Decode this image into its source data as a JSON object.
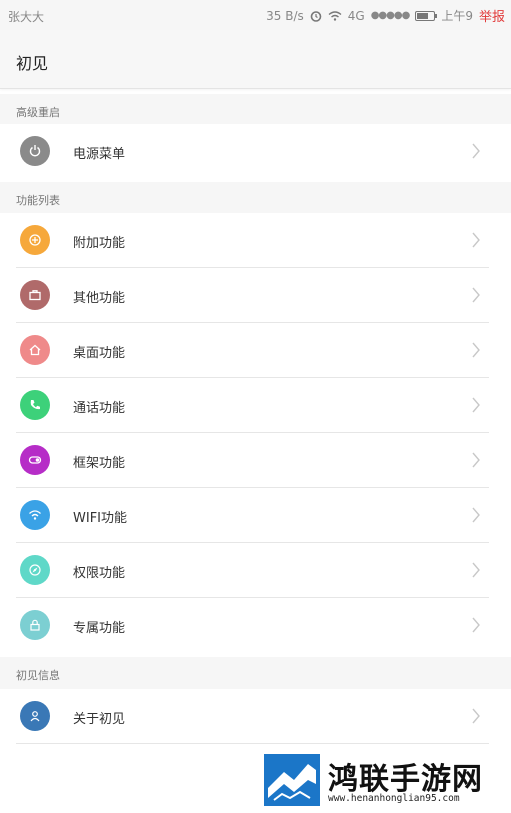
{
  "status_bar": {
    "carrier": "张大大",
    "speed": "35 B/s",
    "network": "4G",
    "signal": "●●●●●",
    "time": "上午9",
    "report": "举报"
  },
  "header": {
    "title": "初见"
  },
  "sections": [
    {
      "title": "高级重启"
    },
    {
      "title": "功能列表"
    },
    {
      "title": "初见信息"
    }
  ],
  "items": [
    {
      "label": "电源菜单",
      "icon": "power-icon",
      "color": "#8a8a8a"
    },
    {
      "label": "附加功能",
      "icon": "plus-icon",
      "color": "#f6a83b"
    },
    {
      "label": "其他功能",
      "icon": "briefcase-icon",
      "color": "#b06a6a"
    },
    {
      "label": "桌面功能",
      "icon": "home-icon",
      "color": "#ef8a8a"
    },
    {
      "label": "通话功能",
      "icon": "phone-icon",
      "color": "#3dd17a"
    },
    {
      "label": "框架功能",
      "icon": "toggle-icon",
      "color": "#b62dc7"
    },
    {
      "label": "WIFI功能",
      "icon": "wifi-icon",
      "color": "#3aa2e6"
    },
    {
      "label": "权限功能",
      "icon": "compass-icon",
      "color": "#5fd8c8"
    },
    {
      "label": "专属功能",
      "icon": "lock-icon",
      "color": "#7ccfd2"
    },
    {
      "label": "关于初见",
      "icon": "user-icon",
      "color": "#3a78b6"
    }
  ],
  "watermark": {
    "title": "鸿联手游网",
    "url": "www.henanhonglian95.com"
  }
}
